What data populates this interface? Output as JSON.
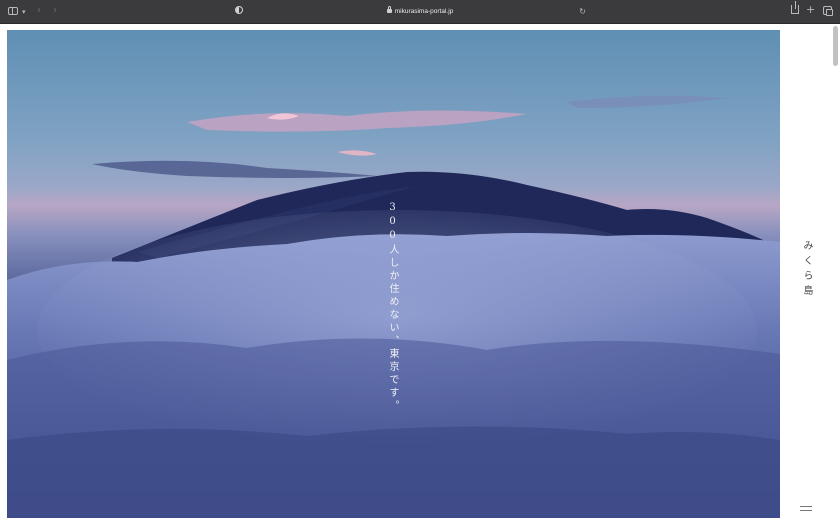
{
  "browser": {
    "url": "mikurasima-portal.jp"
  },
  "site": {
    "title": "みくら島",
    "tagline": "300人しか住めない、東京です。"
  },
  "icons": {
    "sidebar": "sidebar-icon",
    "back": "chevron-left-icon",
    "forward": "chevron-right-icon",
    "privacy": "shield-icon",
    "secure": "lock-icon",
    "reload": "reload-icon",
    "share": "share-icon",
    "new_tab": "plus-icon",
    "tabs": "tab-overview-icon",
    "menu": "hamburger-menu-icon"
  },
  "colors": {
    "toolbar": "#3b3b3d",
    "sky_top": "#5f8fb4",
    "cloud": "#7d8fc4",
    "mountain": "#1e2757"
  }
}
